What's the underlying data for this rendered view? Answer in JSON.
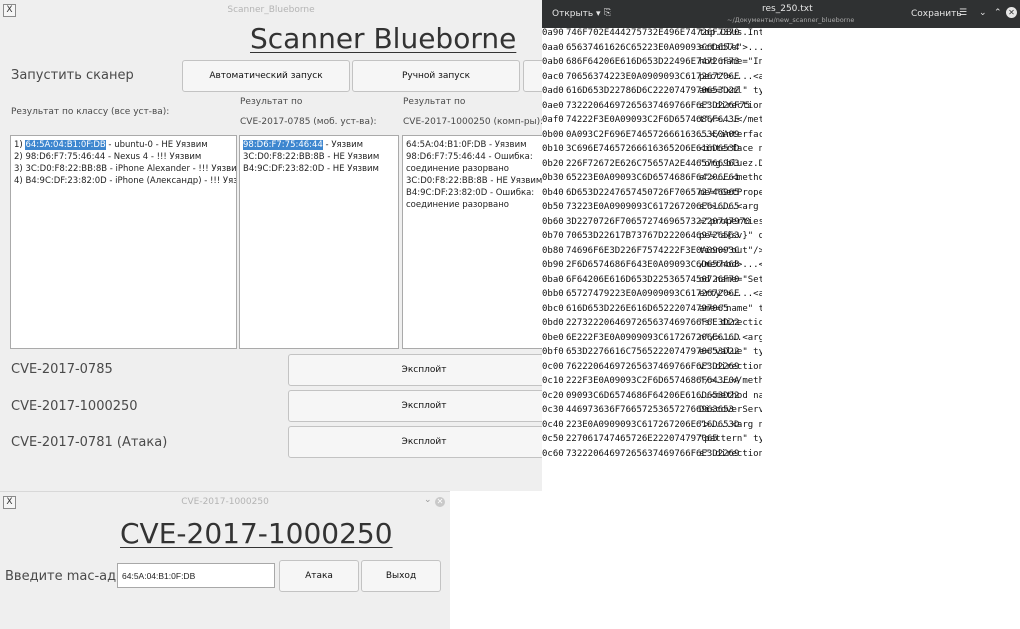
{
  "scanner": {
    "window_title": "Scanner_Blueborne",
    "app_title": "Scanner Blueborne",
    "start_label": "Запустить сканер",
    "auto_button": "Автоматический запуск",
    "manual_button": "Ручной запуск",
    "col1_header": "Результат по классу (все уст-ва):",
    "col2_header_1": "Результат по",
    "col2_header_2": "CVE-2017-0785 (моб. уст-ва):",
    "col3_header_1": "Результат по",
    "col3_header_2": "CVE-2017-1000250 (комп-ры):",
    "list1": [
      {
        "prefix": "1) ",
        "mac": "64:5A:04:B1:0F:DB",
        "rest": " - ubuntu-0 - НЕ Уязвим"
      },
      {
        "prefix": "2) ",
        "mac": "98:D6:F7:75:46:44",
        "rest": " - Nexus 4 - !!! Уязвим"
      },
      {
        "prefix": "3) ",
        "mac": "3C:D0:F8:22:BB:8B",
        "rest": " - iPhone Alexander - !!! Уязвим"
      },
      {
        "prefix": "4) ",
        "mac": "B4:9C:DF:23:82:0D",
        "rest": " - iPhone (Александр) - !!! Уязвим"
      }
    ],
    "list2": [
      {
        "mac": "98:D6:F7:75:46:44",
        "rest": " - Уязвим"
      },
      {
        "mac": "3C:D0:F8:22:BB:8B",
        "rest": " - НЕ Уязвим"
      },
      {
        "mac": "B4:9C:DF:23:82:0D",
        "rest": " - НЕ Уязвим"
      }
    ],
    "list3": [
      "64:5A:04:B1:0F:DB - Уязвим",
      "98:D6:F7:75:46:44 - Ошибка: соединение разорвано",
      "3C:D0:F8:22:BB:8B - НЕ Уязвим",
      "B4:9C:DF:23:82:0D - Ошибка: соединение разорвано"
    ],
    "exploits": [
      {
        "label": "CVE-2017-0785",
        "button": "Эксплойт"
      },
      {
        "label": "CVE-2017-1000250",
        "button": "Эксплойт"
      },
      {
        "label": "CVE-2017-0781 (Атака)",
        "button": "Эксплойт"
      }
    ]
  },
  "cve_dialog": {
    "window_title": "CVE-2017-1000250",
    "title": "CVE-2017-1000250",
    "mac_label": "Введите mac-адрес",
    "mac_value": "64:5A:04:B1:0F:DB",
    "attack_button": "Атака",
    "exit_button": "Выход"
  },
  "editor": {
    "open_button": "Открыть",
    "file_name": "res_250.txt",
    "file_path": "~/Документы/new_scanner_blueborne",
    "save_button": "Сохранить",
    "lines": [
      {
        "addr": "0a90",
        "hex": "746F702E444275732E496E74726F7370",
        "text": "top.DBus.Introsp"
      },
      {
        "addr": "0aa0",
        "hex": "65637461626C65223E0A09093C6D6574",
        "text": "ectable\">...<met"
      },
      {
        "addr": "0ab0",
        "hex": "686F64206E616D653D22496E74726F73",
        "text": "hod name=\"Intros"
      },
      {
        "addr": "0ac0",
        "hex": "70656374223E0A0909093C617267206E",
        "text": "pect\">....<arg n"
      },
      {
        "addr": "0ad0",
        "hex": "616D653D22786D6C2220747970653D22",
        "text": "ame=\"xml\" type=\""
      },
      {
        "addr": "0ae0",
        "hex": "73222064697265637469766F6E3D226F75",
        "text": "s\" direction=\"ou"
      },
      {
        "addr": "0af0",
        "hex": "74222F3E0A09093C2F6D6574686F643E",
        "text": "t\"/>...</method>"
      },
      {
        "addr": "0b00",
        "hex": "0A093C2F696E746572666163653E0A09",
        "text": "..</interface>.."
      },
      {
        "addr": "0b10",
        "hex": "3C696E746572666163652O6E616D653D",
        "text": "<interface name="
      },
      {
        "addr": "0b20",
        "hex": "226F72672E626C75657A2E4465766963",
        "text": "\"org.bluez.Devic"
      },
      {
        "addr": "0b30",
        "hex": "65223E0A09093C6D6574686F64206E61",
        "text": "e\">...<method na"
      },
      {
        "addr": "0b40",
        "hex": "6D653D2247657450726F706572746965",
        "text": "me=\"GetProperties"
      },
      {
        "addr": "0b50",
        "hex": "73223E0A0909093C617267206E616D65",
        "text": "s\">....<arg name"
      },
      {
        "addr": "0b60",
        "hex": "3D2270726F706572746965732220747970",
        "text": "=\"properties\" ty"
      },
      {
        "addr": "0b70",
        "hex": "70653D22617B73767D22206469726563",
        "text": "pe=\"a{sv}\" direc"
      },
      {
        "addr": "0b80",
        "hex": "74696F6E3D226F7574222F3E0A09093C",
        "text": "tion=\"out\"/>...<"
      },
      {
        "addr": "0b90",
        "hex": "2F6D6574686F643E0A09093C6D657468",
        "text": "/method>...<meth"
      },
      {
        "addr": "0ba0",
        "hex": "6F64206E616D653D2253657450726F70",
        "text": "od name=\"SetProp"
      },
      {
        "addr": "0bb0",
        "hex": "65727479223E0A0909093C617267206E",
        "text": "erty\">....<arg n"
      },
      {
        "addr": "0bc0",
        "hex": "616D653D226E616D65222074797065",
        "text": "ame=\"name\" type="
      },
      {
        "addr": "0bd0",
        "hex": "2273222064697265637469766F6E3D22",
        "text": "\"s\" direction=\"i"
      },
      {
        "addr": "0be0",
        "hex": "6E222F3E0A0909093C617267206E616D",
        "text": "n\"/>....<arg nam"
      },
      {
        "addr": "0bf0",
        "hex": "653D2276616C75652220747970653D22",
        "text": "e=\"value\" type=\""
      },
      {
        "addr": "0c00",
        "hex": "76222064697265637469766F6E3D2269",
        "text": "v\" direction=\"in"
      },
      {
        "addr": "0c10",
        "hex": "222F3E0A09093C2F6D6574686F643E0A",
        "text": "\"/>...</method>."
      },
      {
        "addr": "0c20",
        "hex": "09093C6D6574686F64206E616D653D22",
        "text": "..<method name=\""
      },
      {
        "addr": "0c30",
        "hex": "446973636F766572536572766963653",
        "text": "DiscoverServices"
      },
      {
        "addr": "0c40",
        "hex": "223E0A0909093C617267206E616D653D",
        "text": "\">....<arg name="
      },
      {
        "addr": "0c50",
        "hex": "227061747465726E222074797065",
        "text": "\"pattern\" type=\""
      },
      {
        "addr": "0c60",
        "hex": "73222064697265637469766F6E3D2269",
        "text": "s\" direction=\"in"
      }
    ]
  }
}
